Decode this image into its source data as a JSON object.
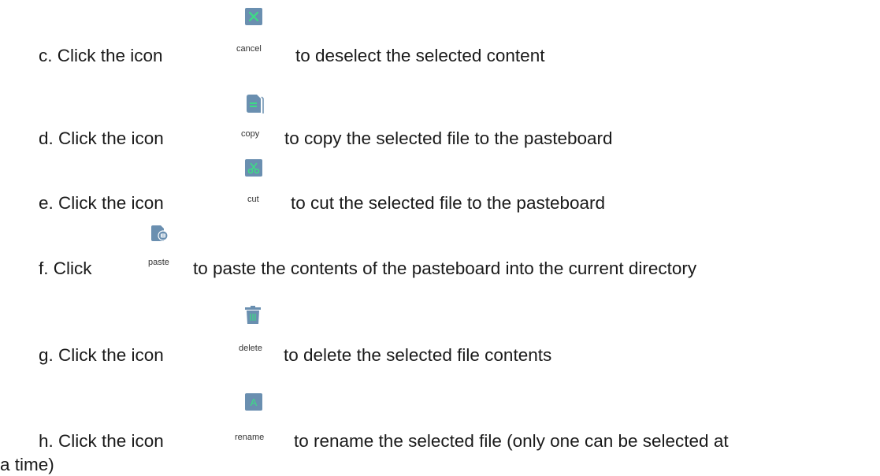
{
  "colors": {
    "icon_fill": "#6a8fb0",
    "icon_accent": "#3ddc84",
    "text": "#1a1a1a"
  },
  "items": [
    {
      "prefix": "c.  Click the icon",
      "icon": "cancel-icon",
      "icon_label": "cancel",
      "suffix": "to deselect the selected content"
    },
    {
      "prefix": "d.  Click the icon",
      "icon": "copy-icon",
      "icon_label": "copy",
      "suffix": "to copy the selected file to the pasteboard"
    },
    {
      "prefix": "e.  Click the icon",
      "icon": "cut-icon",
      "icon_label": "cut",
      "suffix": "to cut the selected file to the pasteboard"
    },
    {
      "prefix": "f.  Click",
      "icon": "paste-icon",
      "icon_label": "paste",
      "suffix": "to paste the contents of the pasteboard into the current directory"
    },
    {
      "prefix": "g.  Click the icon",
      "icon": "delete-icon",
      "icon_label": "delete",
      "suffix": "to delete the selected file contents"
    },
    {
      "prefix": "h.  Click the icon",
      "icon": "rename-icon",
      "icon_label": "rename",
      "suffix": "to rename the selected file (only one can be selected at",
      "continuation": "a time)"
    }
  ]
}
